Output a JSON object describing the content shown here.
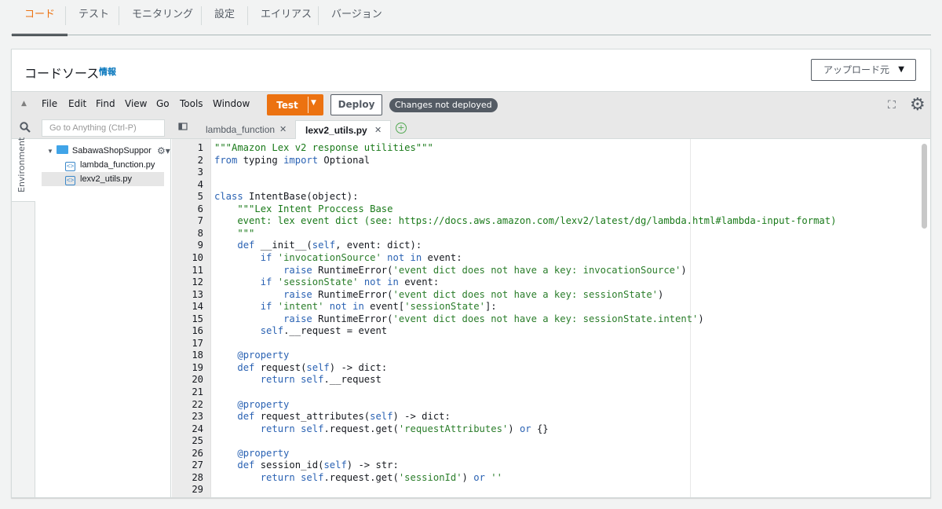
{
  "top_tabs": [
    {
      "label": "コード",
      "active": true
    },
    {
      "label": "テスト"
    },
    {
      "label": "モニタリング"
    },
    {
      "label": "設定"
    },
    {
      "label": "エイリアス"
    },
    {
      "label": "バージョン"
    }
  ],
  "panel": {
    "title": "コードソース",
    "info_link": "情報",
    "upload_button": "アップロード元"
  },
  "toolbar": {
    "menu": [
      "File",
      "Edit",
      "Find",
      "View",
      "Go",
      "Tools",
      "Window"
    ],
    "test_label": "Test",
    "deploy_label": "Deploy",
    "status_badge": "Changes not deployed"
  },
  "search": {
    "placeholder": "Go to Anything (Ctrl-P)"
  },
  "file_tabs": [
    {
      "label": "lambda_function",
      "active": false
    },
    {
      "label": "lexv2_utils.py",
      "active": true
    }
  ],
  "environment_label": "Environment",
  "tree": {
    "folder": "SabawaShopSuppor",
    "files": [
      {
        "name": "lambda_function.py",
        "selected": false
      },
      {
        "name": "lexv2_utils.py",
        "selected": true
      }
    ]
  },
  "code_lines": [
    "\"\"\"Amazon Lex v2 response utilities\"\"\"",
    "from typing import Optional",
    "",
    "",
    "class IntentBase(object):",
    "    \"\"\"Lex Intent Proccess Base",
    "    event: lex event dict (see: https://docs.aws.amazon.com/lexv2/latest/dg/lambda.html#lambda-input-format)",
    "    \"\"\"",
    "    def __init__(self, event: dict):",
    "        if 'invocationSource' not in event:",
    "            raise RuntimeError('event dict does not have a key: invocationSource')",
    "        if 'sessionState' not in event:",
    "            raise RuntimeError('event dict does not have a key: sessionState')",
    "        if 'intent' not in event['sessionState']:",
    "            raise RuntimeError('event dict does not have a key: sessionState.intent')",
    "        self.__request = event",
    "",
    "    @property",
    "    def request(self) -> dict:",
    "        return self.__request",
    "",
    "    @property",
    "    def request_attributes(self) -> dict:",
    "        return self.request.get('requestAttributes') or {}",
    "",
    "    @property",
    "    def session_id(self) -> str:",
    "        return self.request.get('sessionId') or ''",
    ""
  ]
}
